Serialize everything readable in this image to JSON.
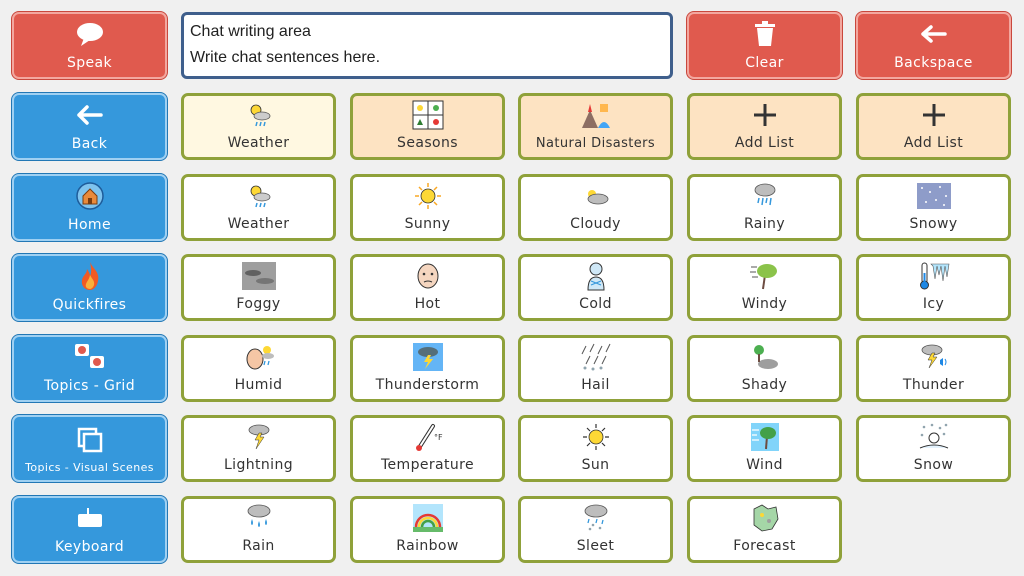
{
  "chat": {
    "line1": "Chat writing area",
    "line2": "Write chat sentences here."
  },
  "toolbar": {
    "speak": "Speak",
    "clear": "Clear",
    "backspace": "Backspace"
  },
  "nav": {
    "back": "Back",
    "home": "Home",
    "quickfires": "Quickfires",
    "topics_grid": "Topics - Grid",
    "topics_visual": "Topics - Visual Scenes",
    "keyboard": "Keyboard"
  },
  "folders": {
    "weather": "Weather",
    "seasons": "Seasons",
    "natural_disasters": "Natural Disasters",
    "add_list_1": "Add List",
    "add_list_2": "Add List"
  },
  "words": {
    "weather": "Weather",
    "sunny": "Sunny",
    "cloudy": "Cloudy",
    "rainy": "Rainy",
    "snowy": "Snowy",
    "foggy": "Foggy",
    "hot": "Hot",
    "cold": "Cold",
    "windy": "Windy",
    "icy": "Icy",
    "humid": "Humid",
    "thunderstorm": "Thunderstorm",
    "hail": "Hail",
    "shady": "Shady",
    "thunder": "Thunder",
    "lightning": "Lightning",
    "temperature": "Temperature",
    "sun": "Sun",
    "wind": "Wind",
    "snow": "Snow",
    "rain": "Rain",
    "rainbow": "Rainbow",
    "sleet": "Sleet",
    "forecast": "Forecast"
  },
  "colors": {
    "red_button": "#e05a4e",
    "blue_button": "#3598dc",
    "green_border": "#8fa13a",
    "folder_cream": "#fff8e1",
    "folder_orange": "#fde3c2"
  }
}
